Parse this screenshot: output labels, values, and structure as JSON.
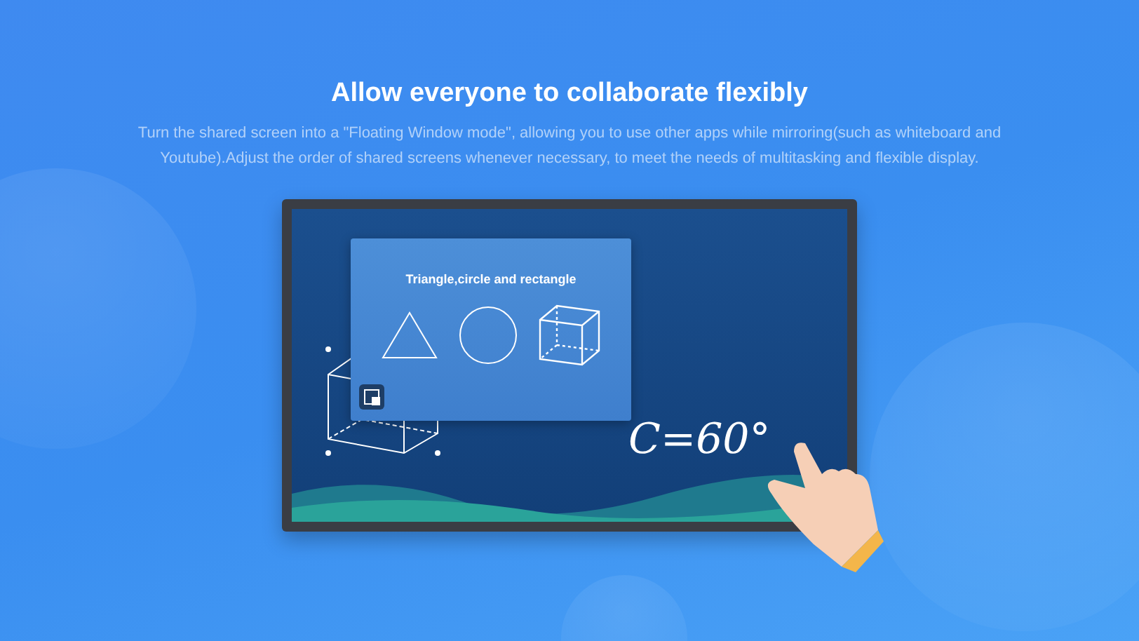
{
  "heading": "Allow everyone to collaborate flexibly",
  "description": "Turn the shared screen into a \"Floating Window mode\", allowing you to use other apps while mirroring(such as whiteboard and Youtube).Adjust the order of shared screens whenever necessary, to meet the needs of multitasking and flexible display.",
  "display": {
    "floating_window": {
      "title": "Triangle,circle and rectangle"
    },
    "handwriting": "C=60°"
  }
}
